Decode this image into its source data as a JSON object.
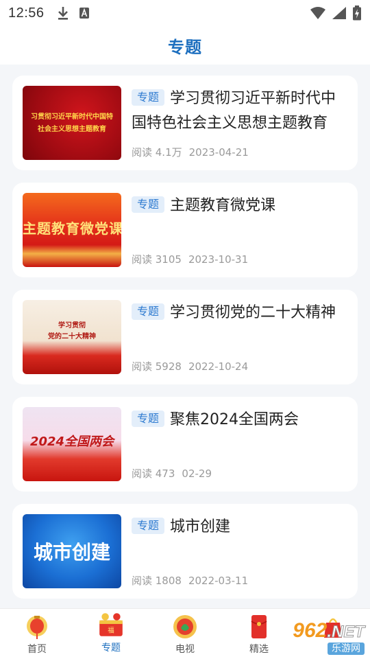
{
  "status_bar": {
    "time": "12:56",
    "icons": [
      "download-icon",
      "a-icon",
      "wifi-icon",
      "signal-icon",
      "battery-icon"
    ]
  },
  "header": {
    "title": "专题"
  },
  "colors": {
    "accent": "#1d6fbf",
    "tag_bg": "#e3eefa",
    "tag_text": "#2d7ad0",
    "meta": "#9a9a9a",
    "background": "#f4f6f9"
  },
  "items": [
    {
      "tag": "专题",
      "title": "学习贯彻习近平新时代中国特色社会主义思想主题教育",
      "reads": "阅读 4.1万",
      "date": "2023-04-21",
      "thumb_lines": [
        "习贯彻习近平新时代中国特",
        "社会主义思想主题教育"
      ]
    },
    {
      "tag": "专题",
      "title": "主题教育微党课",
      "reads": "阅读 3105",
      "date": "2023-10-31",
      "thumb_lines": [
        "主题教育微党课"
      ]
    },
    {
      "tag": "专题",
      "title": "学习贯彻党的二十大精神",
      "reads": "阅读 5928",
      "date": "2022-10-24",
      "thumb_lines": [
        "学习贯彻",
        "党的二十大精神"
      ]
    },
    {
      "tag": "专题",
      "title": "聚焦2024全国两会",
      "reads": "阅读 473",
      "date": "02-29",
      "thumb_lines": [
        "2024全国两会"
      ]
    },
    {
      "tag": "专题",
      "title": "城市创建",
      "reads": "阅读 1808",
      "date": "2022-03-11",
      "thumb_lines": [
        "城市创建"
      ]
    }
  ],
  "tabbar": {
    "tabs": [
      {
        "label": "首页",
        "icon": "lantern-icon"
      },
      {
        "label": "专题",
        "icon": "gift-basket-icon",
        "active": true
      },
      {
        "label": "电视",
        "icon": "tv-icon"
      },
      {
        "label": "精选",
        "icon": "red-envelope-icon"
      },
      {
        "label": "",
        "icon": "gift-bag-icon"
      }
    ]
  },
  "watermark": {
    "logo": "962",
    "logo_suffix": ".NET",
    "sub": "乐游网"
  }
}
